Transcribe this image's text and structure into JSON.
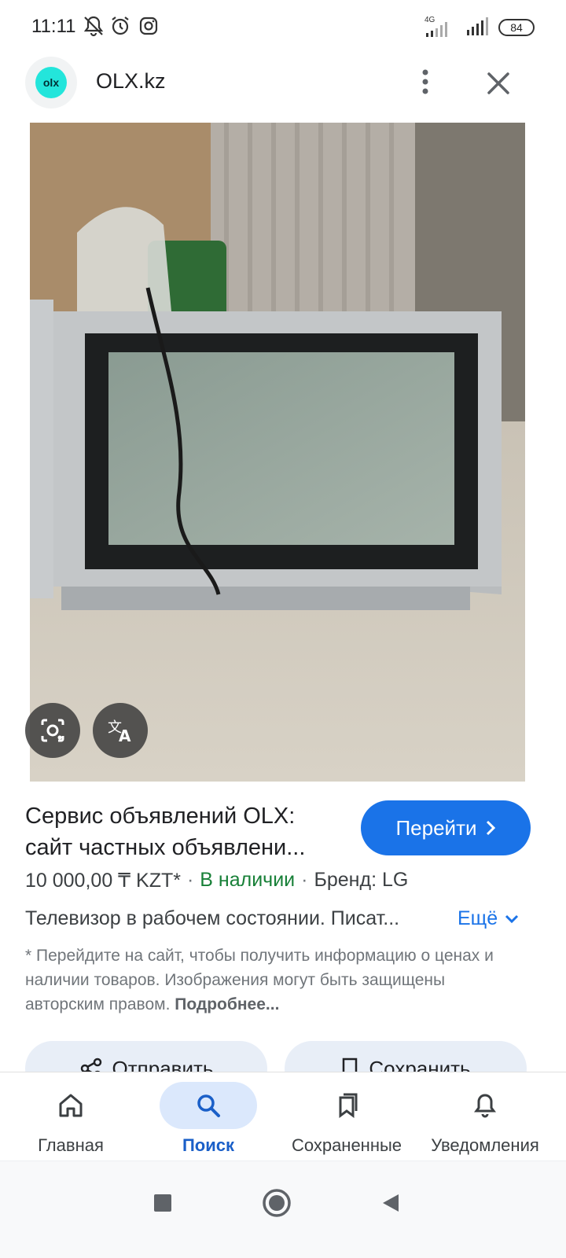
{
  "status_bar": {
    "time": "11:11",
    "network_label": "4G",
    "battery_level": "84",
    "icons": [
      "notifications-off-icon",
      "alarm-icon",
      "instagram-icon",
      "signal-icon",
      "signal-icon",
      "battery-icon"
    ]
  },
  "header": {
    "logo_text": "olx",
    "site_title": "OLX.kz",
    "more_icon": "more-vert-icon",
    "close_icon": "close-icon"
  },
  "image_overlay": {
    "lens_icon": "lens-icon",
    "translate_icon": "translate-icon"
  },
  "result": {
    "title_line1": "Сервис объявлений OLX:",
    "title_line2": "сайт частных объявлени...",
    "go_button_label": "Перейти",
    "price": "10 000,00 ₸ KZT*",
    "separator": "·",
    "availability": "В наличии",
    "brand": "Бренд: LG",
    "description": "Телевизор в рабочем состоянии. Писат...",
    "more_label": "Ещё",
    "disclaimer_text": "* Перейдите на сайт, чтобы получить информацию о ценах и наличии товаров. Изображения могут быть защищены авторским правом.",
    "disclaimer_link": "Подробнее..."
  },
  "actions": {
    "share_label": "Отправить",
    "save_label": "Сохранить"
  },
  "bottom_nav": {
    "items": [
      {
        "label": "Главная",
        "icon": "home-icon",
        "active": false
      },
      {
        "label": "Поиск",
        "icon": "search-icon",
        "active": true
      },
      {
        "label": "Сохраненные",
        "icon": "collections-icon",
        "active": false
      },
      {
        "label": "Уведомления",
        "icon": "bell-icon",
        "active": false
      }
    ]
  },
  "colors": {
    "accent": "#1a73e8",
    "in_stock": "#188038",
    "olx_teal": "#23e5db"
  }
}
